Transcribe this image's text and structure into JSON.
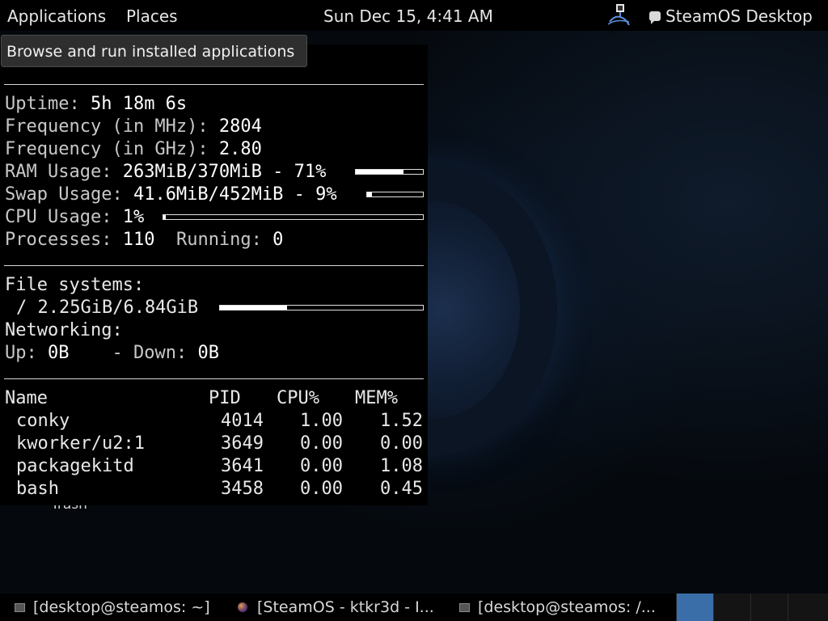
{
  "top_panel": {
    "applications_label": "Applications",
    "places_label": "Places",
    "clock": "Sun Dec 15,  4:41 AM",
    "session_label": "SteamOS Desktop"
  },
  "tooltip": {
    "text": "Browse and run installed applications"
  },
  "conky": {
    "uptime_label": "Uptime:",
    "uptime_value": "5h 18m 6s",
    "freq_mhz_label": "Frequency (in MHz):",
    "freq_mhz_value": "2804",
    "freq_ghz_label": "Frequency (in GHz):",
    "freq_ghz_value": "2.80",
    "ram_label": "RAM Usage:",
    "ram_value": "263MiB/370MiB - 71%",
    "ram_fraction": 0.71,
    "swap_label": "Swap Usage:",
    "swap_value": "41.6MiB/452MiB - 9%",
    "swap_fraction": 0.09,
    "cpu_label": "CPU Usage:",
    "cpu_value": "1%",
    "cpu_fraction": 0.01,
    "processes_label": "Processes:",
    "processes_value": "110",
    "running_label": "Running:",
    "running_value": "0",
    "fs_label": "File systems:",
    "fs_root": "/ 2.25GiB/6.84GiB",
    "fs_fraction": 0.33,
    "net_label": "Networking:",
    "up_label": "Up:",
    "up_value": "0B",
    "down_label": "- Down:",
    "down_value": "0B",
    "table_headers": {
      "name": "Name",
      "pid": "PID",
      "cpu": "CPU%",
      "mem": "MEM%"
    },
    "processes": [
      {
        "name": "conky",
        "pid": "4014",
        "cpu": "1.00",
        "mem": "1.52"
      },
      {
        "name": "kworker/u2:1",
        "pid": "3649",
        "cpu": "0.00",
        "mem": "0.00"
      },
      {
        "name": "packagekitd",
        "pid": "3641",
        "cpu": "0.00",
        "mem": "1.08"
      },
      {
        "name": "bash",
        "pid": "3458",
        "cpu": "0.00",
        "mem": "0.45"
      }
    ]
  },
  "desktop": {
    "trash_label": "Trash"
  },
  "taskbar": {
    "tasks": [
      {
        "label": "[desktop@steamos: ~]",
        "icon": "terminal-icon"
      },
      {
        "label": "[SteamOS - ktkr3d - I...",
        "icon": "browser-icon"
      },
      {
        "label": "[desktop@steamos: /...",
        "icon": "terminal-icon"
      }
    ],
    "workspaces": 4,
    "active_workspace": 1
  },
  "colors": {
    "panel_bg": "#000000",
    "workspace_active": "#3a6ea8",
    "desktop_bg": "#05090e"
  }
}
